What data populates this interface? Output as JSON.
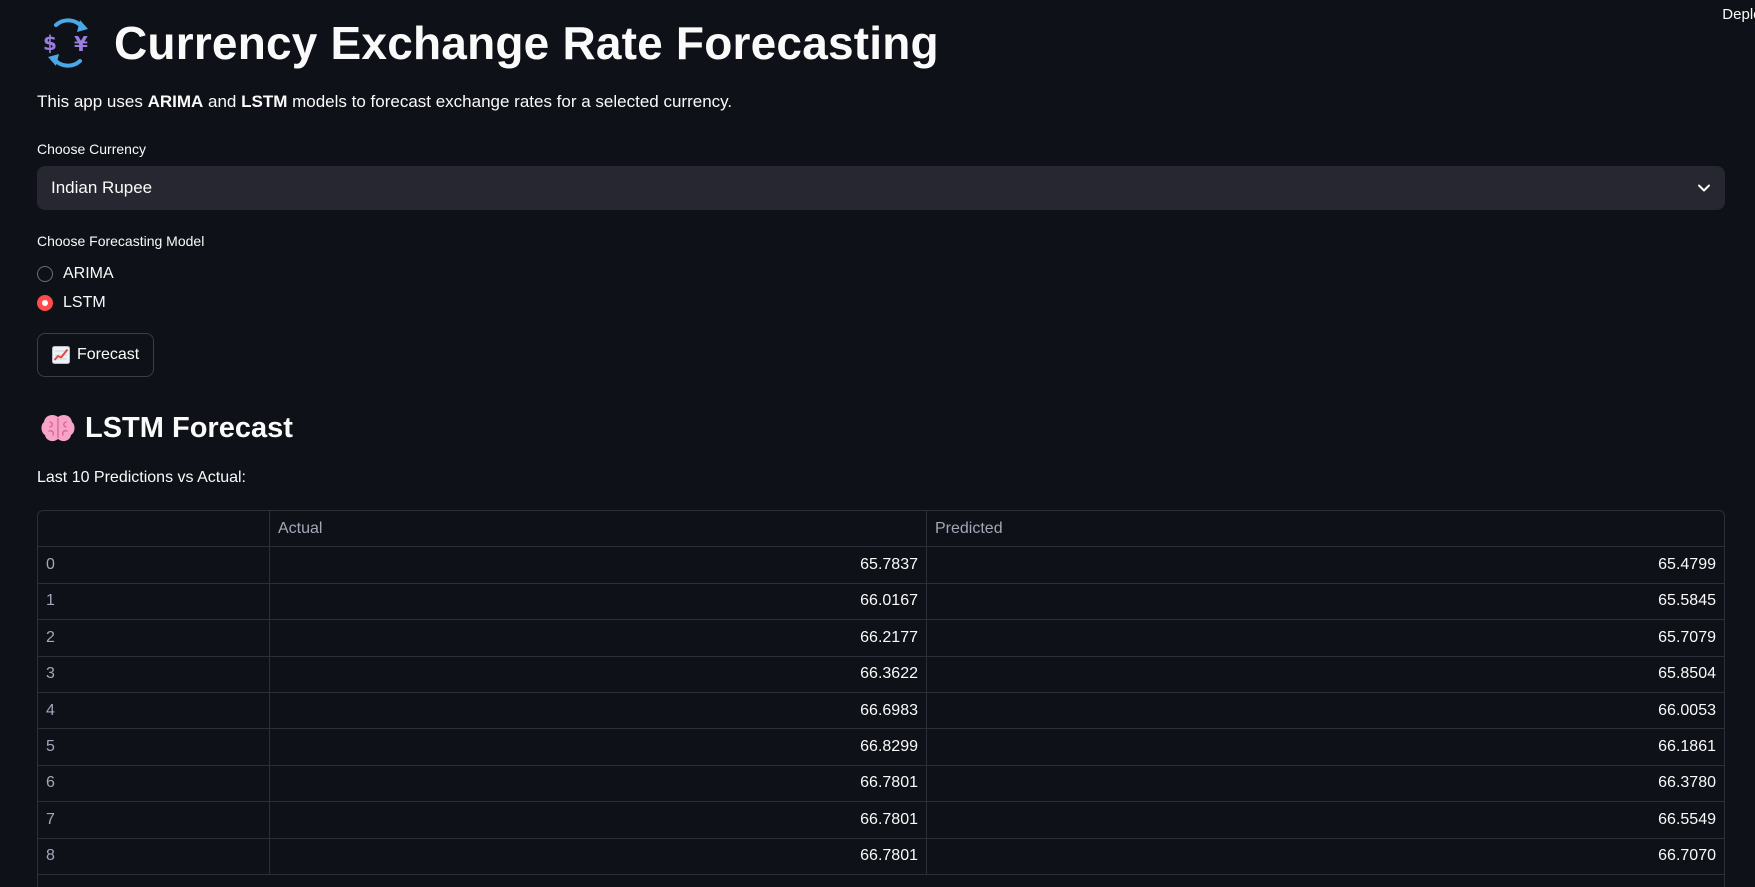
{
  "header": {
    "deploy_label": "Deploy",
    "title": "Currency Exchange Rate Forecasting",
    "title_icon": "currency-exchange-icon"
  },
  "intro": {
    "prefix": "This app uses ",
    "model1": "ARIMA",
    "middle": " and ",
    "model2": "LSTM",
    "suffix": " models to forecast exchange rates for a selected currency."
  },
  "currency_select": {
    "label": "Choose Currency",
    "value": "Indian Rupee",
    "icon": "chevron-down-icon"
  },
  "model_radio": {
    "label": "Choose Forecasting Model",
    "options": [
      {
        "label": "ARIMA",
        "selected": false
      },
      {
        "label": "LSTM",
        "selected": true
      }
    ],
    "accent_color": "#ff4b4b"
  },
  "forecast_button": {
    "label": "Forecast",
    "icon": "chart-increasing-icon"
  },
  "results": {
    "title": "LSTM Forecast",
    "title_icon": "brain-icon",
    "caption": "Last 10 Predictions vs Actual:"
  },
  "table": {
    "columns": [
      "",
      "Actual",
      "Predicted"
    ],
    "rows": [
      {
        "index": "0",
        "actual": "65.7837",
        "predicted": "65.4799"
      },
      {
        "index": "1",
        "actual": "66.0167",
        "predicted": "65.5845"
      },
      {
        "index": "2",
        "actual": "66.2177",
        "predicted": "65.7079"
      },
      {
        "index": "3",
        "actual": "66.3622",
        "predicted": "65.8504"
      },
      {
        "index": "4",
        "actual": "66.6983",
        "predicted": "66.0053"
      },
      {
        "index": "5",
        "actual": "66.8299",
        "predicted": "66.1861"
      },
      {
        "index": "6",
        "actual": "66.7801",
        "predicted": "66.3780"
      },
      {
        "index": "7",
        "actual": "66.7801",
        "predicted": "66.5549"
      },
      {
        "index": "8",
        "actual": "66.7801",
        "predicted": "66.7070"
      }
    ]
  },
  "colors": {
    "background": "#0e1117",
    "surface": "#262730",
    "text": "#fafafa",
    "accent": "#ff4b4b"
  }
}
